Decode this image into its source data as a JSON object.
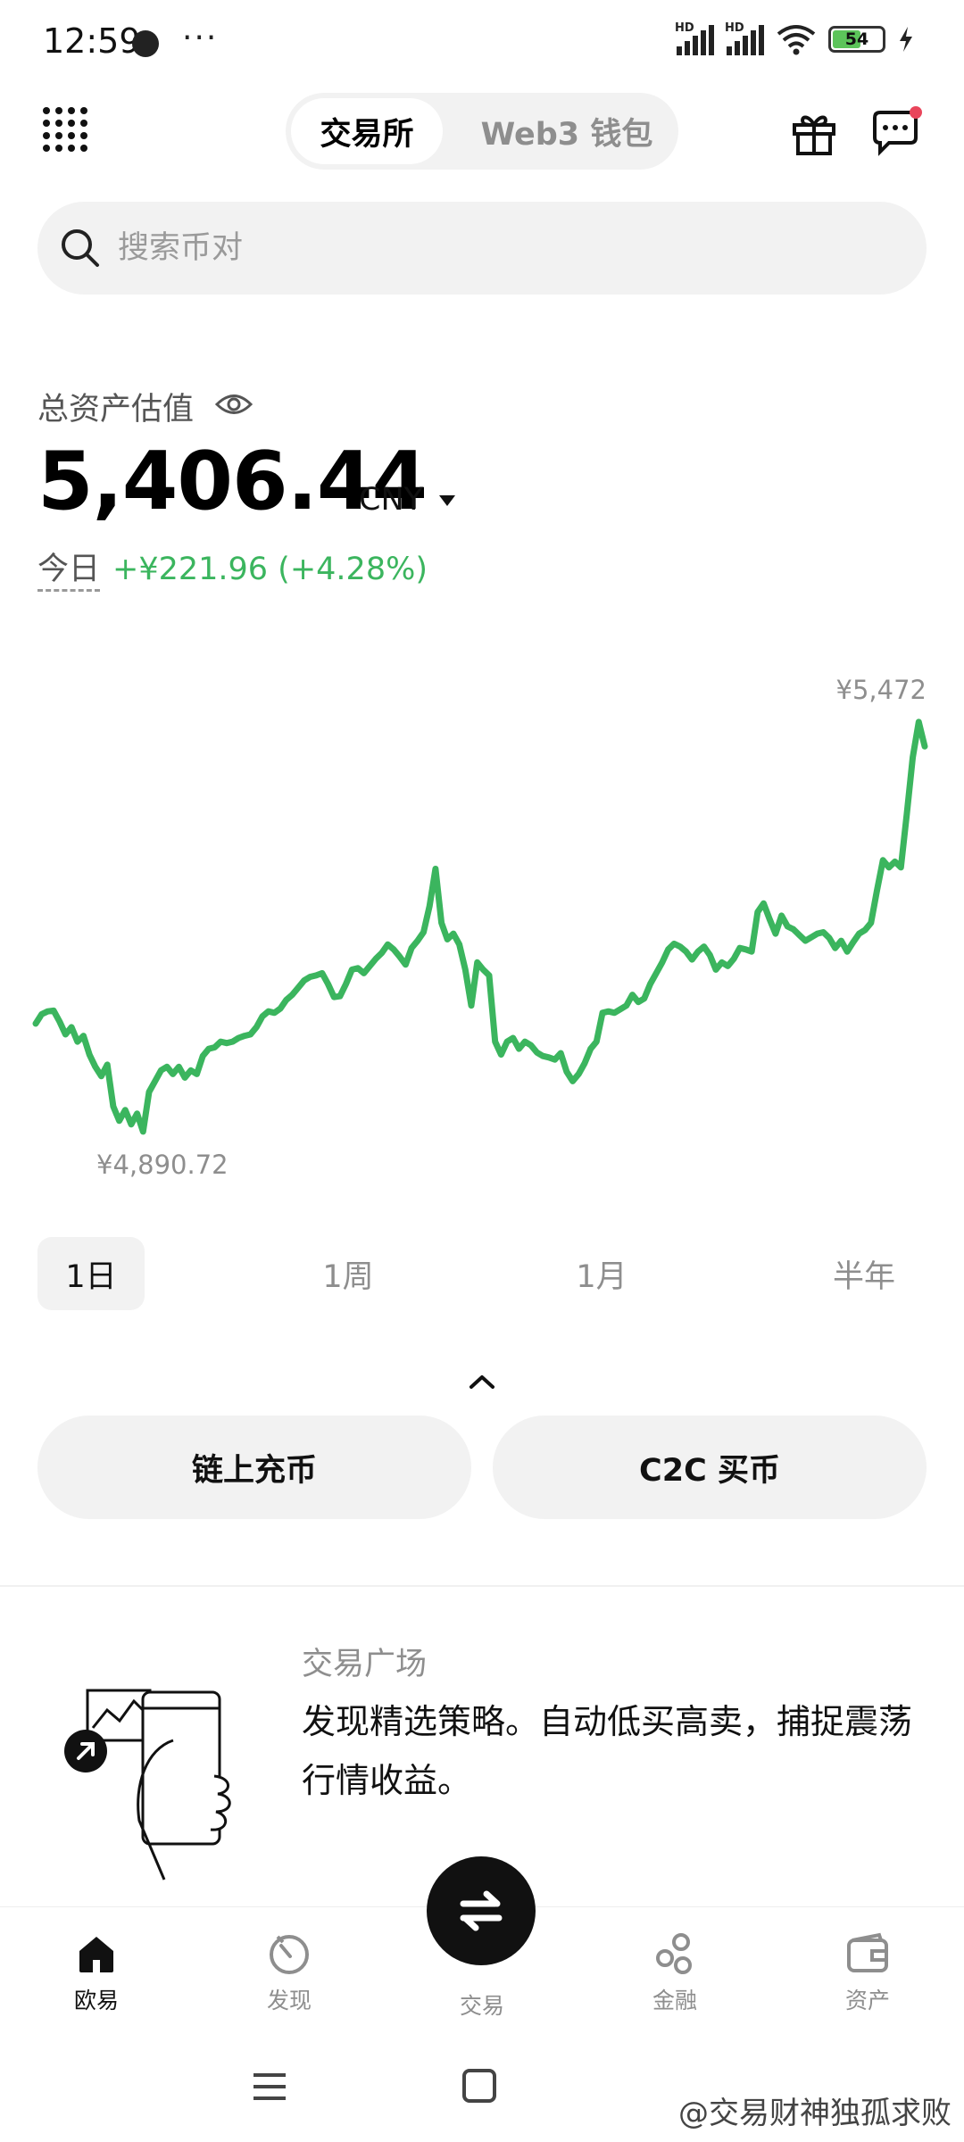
{
  "status_bar": {
    "time": "12:59",
    "more": "···",
    "battery": "54"
  },
  "header": {
    "tabs": [
      "交易所",
      "Web3 钱包"
    ],
    "active_tab": 0
  },
  "search": {
    "placeholder": "搜索币对"
  },
  "assets": {
    "label": "总资产估值",
    "value": "5,406.44",
    "currency": "CNY",
    "today_label": "今日",
    "change": "+¥221.96 (+4.28%)"
  },
  "chart_data": {
    "type": "line",
    "max_label": "¥5,472",
    "min_label": "¥4,890.72",
    "color": "#3bb55e",
    "ylim": [
      4880,
      5480
    ],
    "values": [
      5045,
      5058,
      5062,
      5063,
      5048,
      5030,
      5040,
      5020,
      5028,
      5002,
      4985,
      4972,
      4988,
      4930,
      4910,
      4925,
      4905,
      4920,
      4895,
      4950,
      4965,
      4980,
      4985,
      4975,
      4985,
      4970,
      4980,
      4975,
      5000,
      5010,
      5012,
      5020,
      5018,
      5020,
      5025,
      5028,
      5030,
      5040,
      5055,
      5062,
      5060,
      5066,
      5078,
      5085,
      5095,
      5105,
      5110,
      5112,
      5115,
      5100,
      5082,
      5083,
      5100,
      5120,
      5122,
      5115,
      5125,
      5135,
      5143,
      5155,
      5148,
      5138,
      5127,
      5150,
      5160,
      5172,
      5208,
      5260,
      5185,
      5162,
      5170,
      5155,
      5120,
      5070,
      5130,
      5120,
      5112,
      5020,
      5002,
      5020,
      5025,
      5010,
      5020,
      5015,
      5005,
      5000,
      4998,
      4995,
      5004,
      4978,
      4965,
      4975,
      4990,
      5010,
      5020,
      5060,
      5062,
      5060,
      5065,
      5070,
      5085,
      5075,
      5080,
      5100,
      5115,
      5130,
      5148,
      5156,
      5152,
      5145,
      5134,
      5145,
      5152,
      5140,
      5120,
      5130,
      5125,
      5135,
      5150,
      5148,
      5145,
      5200,
      5212,
      5190,
      5170,
      5195,
      5180,
      5176,
      5168,
      5160,
      5165,
      5170,
      5172,
      5164,
      5150,
      5160,
      5145,
      5158,
      5170,
      5175,
      5185,
      5230,
      5272,
      5262,
      5270,
      5262,
      5336,
      5415,
      5464,
      5430
    ]
  },
  "periods": [
    "1日",
    "1周",
    "1月",
    "半年"
  ],
  "active_period": 0,
  "actions": {
    "deposit": "链上充币",
    "c2c": "C2C 买币"
  },
  "promo": {
    "tag": "交易广场",
    "text": "发现精选策略。自动低买高卖，捕捉震荡行情收益。"
  },
  "nav": {
    "items": [
      "欧易",
      "发现",
      "交易",
      "金融",
      "资产"
    ],
    "active": 0
  },
  "watermark": "@交易财神独孤求败"
}
